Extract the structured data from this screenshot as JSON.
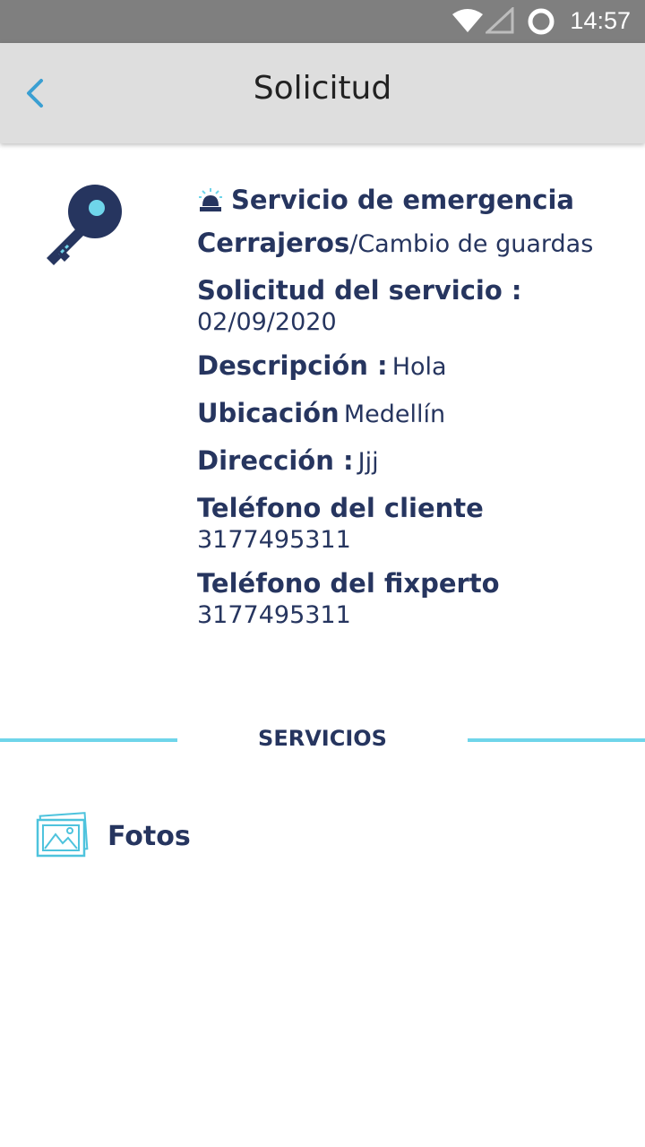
{
  "status_bar": {
    "time": "14:57"
  },
  "header": {
    "title": "Solicitud"
  },
  "request": {
    "service_type": "Servicio de emergencia",
    "category_label": "Cerrajeros",
    "category_value": "/Cambio de guardas",
    "request_date_label": "Solicitud del servicio :",
    "request_date_value": "02/09/2020",
    "description_label": "Descripción :",
    "description_value": "Hola",
    "location_label": "Ubicación",
    "location_value": "Medellín",
    "address_label": "Dirección :",
    "address_value": "Jjj",
    "client_phone_label": "Teléfono del cliente",
    "client_phone_value": "3177495311",
    "expert_phone_label": "Teléfono del fixperto",
    "expert_phone_value": "3177495311"
  },
  "services_section": {
    "title": "SERVICIOS",
    "photos_label": "Fotos"
  },
  "colors": {
    "accent": "#6fd5ea",
    "text": "#26355f",
    "appbar": "#dedede",
    "statusbar": "#7f7f7f"
  }
}
